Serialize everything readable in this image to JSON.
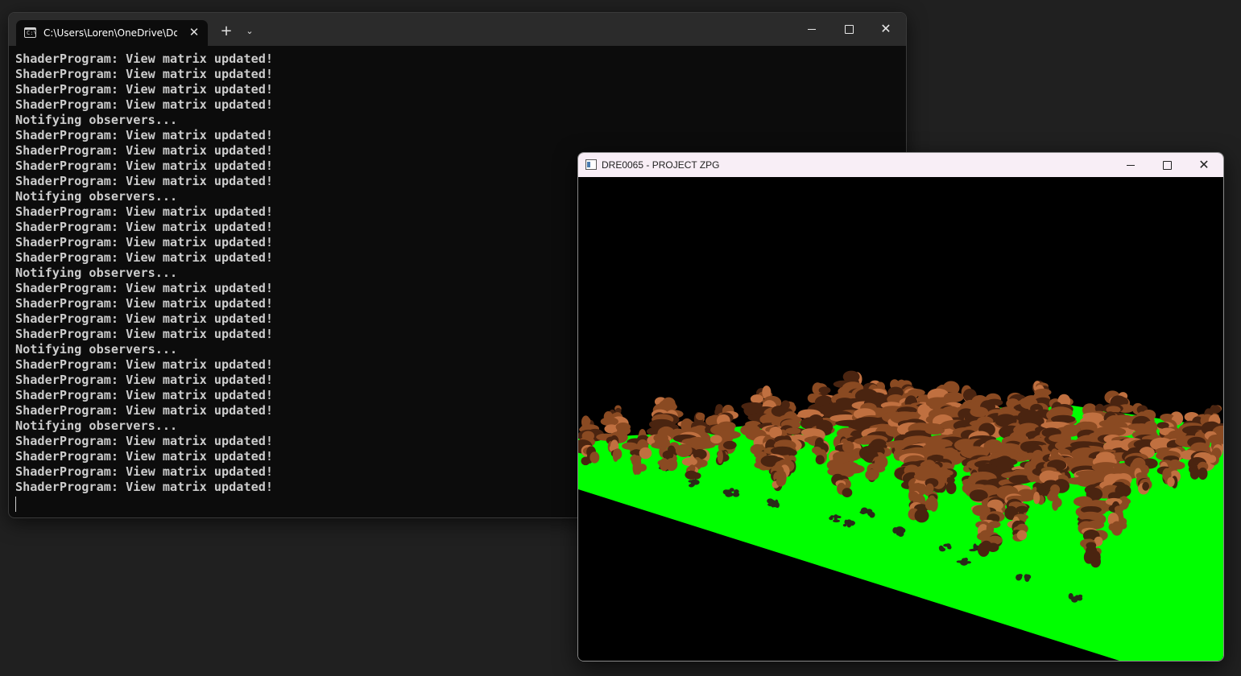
{
  "terminal": {
    "tab_title": "C:\\Users\\Loren\\OneDrive\\Dokumenty",
    "tab_icon_text": "C:\\",
    "new_tab_glyph": "+",
    "dropdown_glyph": "⌄",
    "tab_close_glyph": "✕",
    "close_glyph": "✕",
    "lines": [
      "ShaderProgram: View matrix updated!",
      "ShaderProgram: View matrix updated!",
      "ShaderProgram: View matrix updated!",
      "ShaderProgram: View matrix updated!",
      "Notifying observers...",
      "ShaderProgram: View matrix updated!",
      "ShaderProgram: View matrix updated!",
      "ShaderProgram: View matrix updated!",
      "ShaderProgram: View matrix updated!",
      "Notifying observers...",
      "ShaderProgram: View matrix updated!",
      "ShaderProgram: View matrix updated!",
      "ShaderProgram: View matrix updated!",
      "ShaderProgram: View matrix updated!",
      "Notifying observers...",
      "ShaderProgram: View matrix updated!",
      "ShaderProgram: View matrix updated!",
      "ShaderProgram: View matrix updated!",
      "ShaderProgram: View matrix updated!",
      "Notifying observers...",
      "ShaderProgram: View matrix updated!",
      "ShaderProgram: View matrix updated!",
      "ShaderProgram: View matrix updated!",
      "ShaderProgram: View matrix updated!",
      "Notifying observers...",
      "ShaderProgram: View matrix updated!",
      "ShaderProgram: View matrix updated!",
      "ShaderProgram: View matrix updated!",
      "ShaderProgram: View matrix updated!"
    ]
  },
  "gl_window": {
    "title": "DRE0065 - PROJECT ZPG",
    "close_glyph": "✕",
    "scene": {
      "sky_color": "#000000",
      "ground_color": "#00ff00",
      "tree_color": "#8a4a22",
      "tree_shadow_color": "#4a2410",
      "tree_highlight_color": "#c07040",
      "bush_color": "#2a2a1a"
    }
  },
  "colors": {
    "desktop": "#202020",
    "terminal_bg": "#0c0c0c",
    "terminal_text": "#cccccc"
  }
}
